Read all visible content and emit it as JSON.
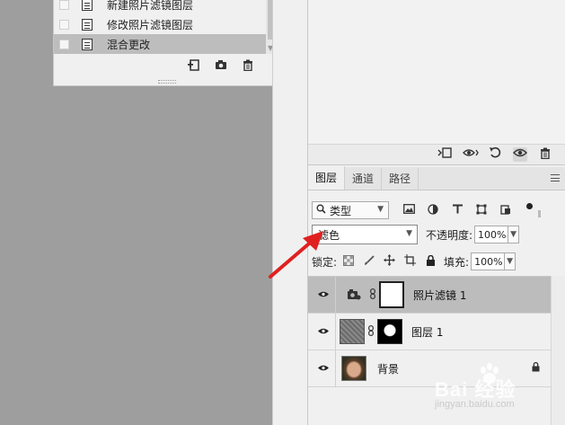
{
  "history": {
    "items": [
      {
        "label": "新建照片滤镜图层",
        "active": false
      },
      {
        "label": "修改照片滤镜图层",
        "active": false
      },
      {
        "label": "混合更改",
        "active": true
      }
    ],
    "tool_icons": [
      "new-snapshot-icon",
      "camera-icon",
      "trash-icon"
    ]
  },
  "top_panel": {
    "tool_icons": [
      "clip-icon",
      "eye-previous-icon",
      "reset-icon",
      "eye-icon",
      "trash-icon"
    ]
  },
  "layers_panel": {
    "tabs": [
      {
        "label": "图层",
        "active": true
      },
      {
        "label": "通道",
        "active": false
      },
      {
        "label": "路径",
        "active": false
      }
    ],
    "filter": {
      "kind_label": "类型",
      "icons": [
        "image-filter-icon",
        "adjustment-filter-icon",
        "type-filter-icon",
        "shape-filter-icon",
        "smart-object-filter-icon"
      ]
    },
    "blend_mode": "滤色",
    "opacity_label": "不透明度:",
    "opacity_value": "100%",
    "lock_label": "锁定:",
    "fill_label": "填充:",
    "fill_value": "100%",
    "layers": [
      {
        "name": "照片滤镜 1",
        "type": "adjustment",
        "active": true
      },
      {
        "name": "图层 1",
        "type": "pixel",
        "active": false
      },
      {
        "name": "背景",
        "type": "background",
        "active": false,
        "locked": true
      }
    ]
  },
  "watermark": {
    "text": "Bai  经验",
    "sub": "jingyan.baidu.com"
  }
}
